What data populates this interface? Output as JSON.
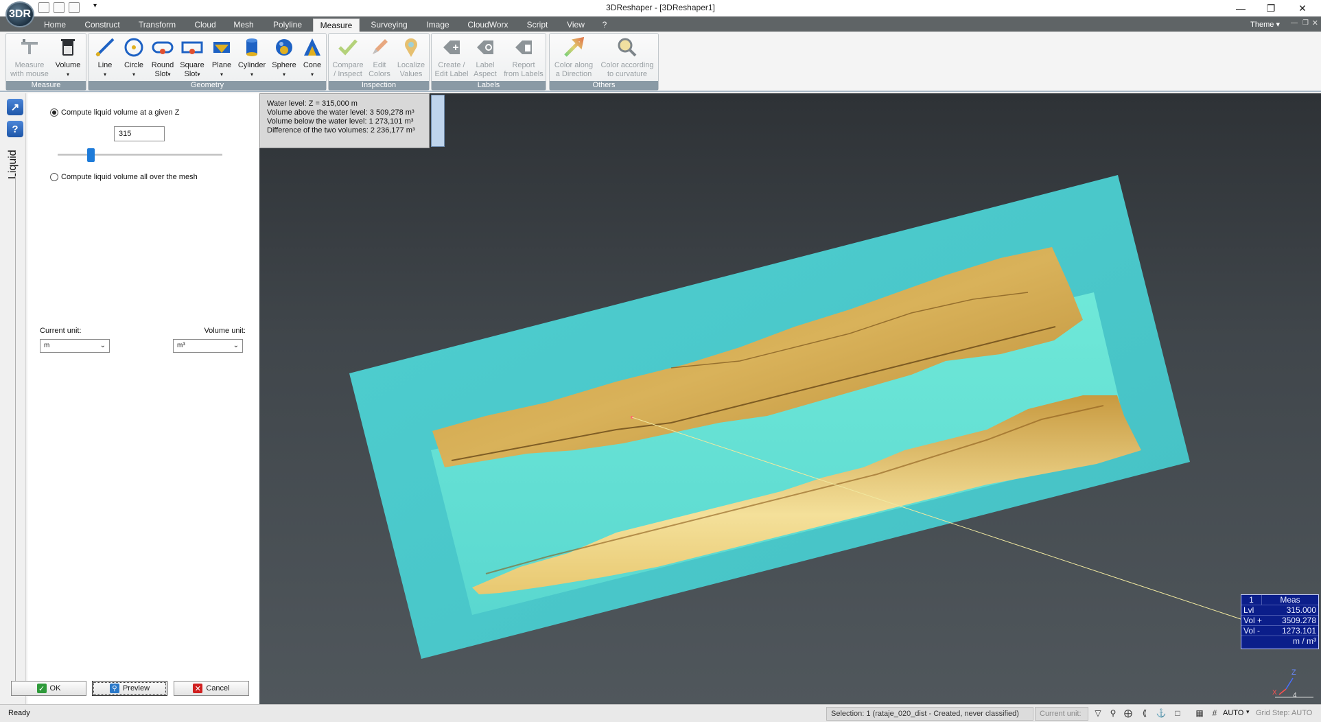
{
  "window": {
    "title": "3DReshaper - [3DReshaper1]",
    "logo_text": "3DR"
  },
  "menu": {
    "tabs": [
      "Home",
      "Construct",
      "Transform",
      "Cloud",
      "Mesh",
      "Polyline",
      "Measure",
      "Surveying",
      "Image",
      "CloudWorx",
      "Script",
      "View",
      "?"
    ],
    "active": "Measure",
    "theme_label": "Theme"
  },
  "ribbon": {
    "groups": {
      "measure": "Measure",
      "geometry": "Geometry",
      "inspection": "Inspection",
      "labels": "Labels",
      "others": "Others"
    },
    "buttons": {
      "measure_mouse": "Measure\nwith mouse",
      "volume": "Volume",
      "line": "Line",
      "circle": "Circle",
      "round_slot": "Round\nSlot",
      "square_slot": "Square\nSlot",
      "plane": "Plane",
      "cylinder": "Cylinder",
      "sphere": "Sphere",
      "cone": "Cone",
      "compare_inspect": "Compare\n/ Inspect",
      "edit_colors": "Edit\nColors",
      "localize_values": "Localize\nValues",
      "create_edit_label": "Create /\nEdit Label",
      "label_aspect": "Label\nAspect",
      "report_labels": "Report\nfrom Labels",
      "color_direction": "Color along\na Direction",
      "color_curvature": "Color according\nto curvature"
    },
    "icons": {
      "measure_mouse": "caliper-icon",
      "volume": "beaker-icon",
      "line": "line-icon",
      "circle": "circle-icon",
      "round_slot": "round-slot-icon",
      "square_slot": "square-slot-icon",
      "plane": "plane-icon",
      "cylinder": "cylinder-icon",
      "sphere": "sphere-icon",
      "cone": "cone-icon",
      "compare_inspect": "check-icon",
      "edit_colors": "pencil-icon",
      "localize_values": "pin-icon",
      "create_edit_label": "tag-plus-icon",
      "label_aspect": "tag-gear-icon",
      "report_labels": "report-icon",
      "color_direction": "gradient-arrow-icon",
      "color_curvature": "magnifier-icon"
    }
  },
  "panel": {
    "title": "Liquid",
    "option_z": "Compute liquid volume at a given Z",
    "z_value": "315",
    "slider_fraction": 0.17,
    "option_mesh": "Compute liquid volume all over the mesh",
    "current_unit_label": "Current unit:",
    "current_unit_value": "m",
    "volume_unit_label": "Volume unit:",
    "volume_unit_value": "m³",
    "ok": "OK",
    "preview": "Preview",
    "cancel": "Cancel"
  },
  "viewport": {
    "info_lines": [
      "Water level: Z = 315,000 m",
      "Volume above the water level: 3 509,278 m³",
      "Volume below the water level: 1 273,101 m³",
      "Difference of the two volumes: 2 236,177 m³"
    ],
    "meas_label": {
      "index": "1",
      "header": "Meas",
      "rows": [
        {
          "k": "Lvl",
          "v": "315.000"
        },
        {
          "k": "Vol +",
          "v": "3509.278"
        },
        {
          "k": "Vol -",
          "v": "1273.101"
        }
      ],
      "units": "m / m³"
    },
    "axis": {
      "z": "Z",
      "x": "X",
      "scale": "4"
    },
    "colors": {
      "water": "#4fcfd0",
      "terrain_dark": "#9a6a1e",
      "terrain_light": "#f2dc8c"
    }
  },
  "status": {
    "ready": "Ready",
    "selection": "Selection: 1 (rataje_020_dist - Created, never classified)",
    "current_unit": "Current unit:",
    "auto": "AUTO",
    "grid_step": "Grid Step: AUTO"
  }
}
